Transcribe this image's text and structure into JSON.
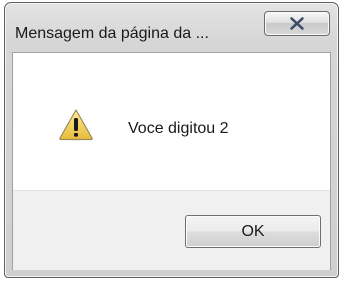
{
  "dialog": {
    "title": "Mensagem da página da ...",
    "message": "Voce digitou 2",
    "ok_label": "OK",
    "icon": "warning-icon"
  },
  "titlebar": {
    "close_icon": "close-icon"
  },
  "colors": {
    "warning_fill": "#f2d46b",
    "close_glyph": "#3c4a66"
  }
}
